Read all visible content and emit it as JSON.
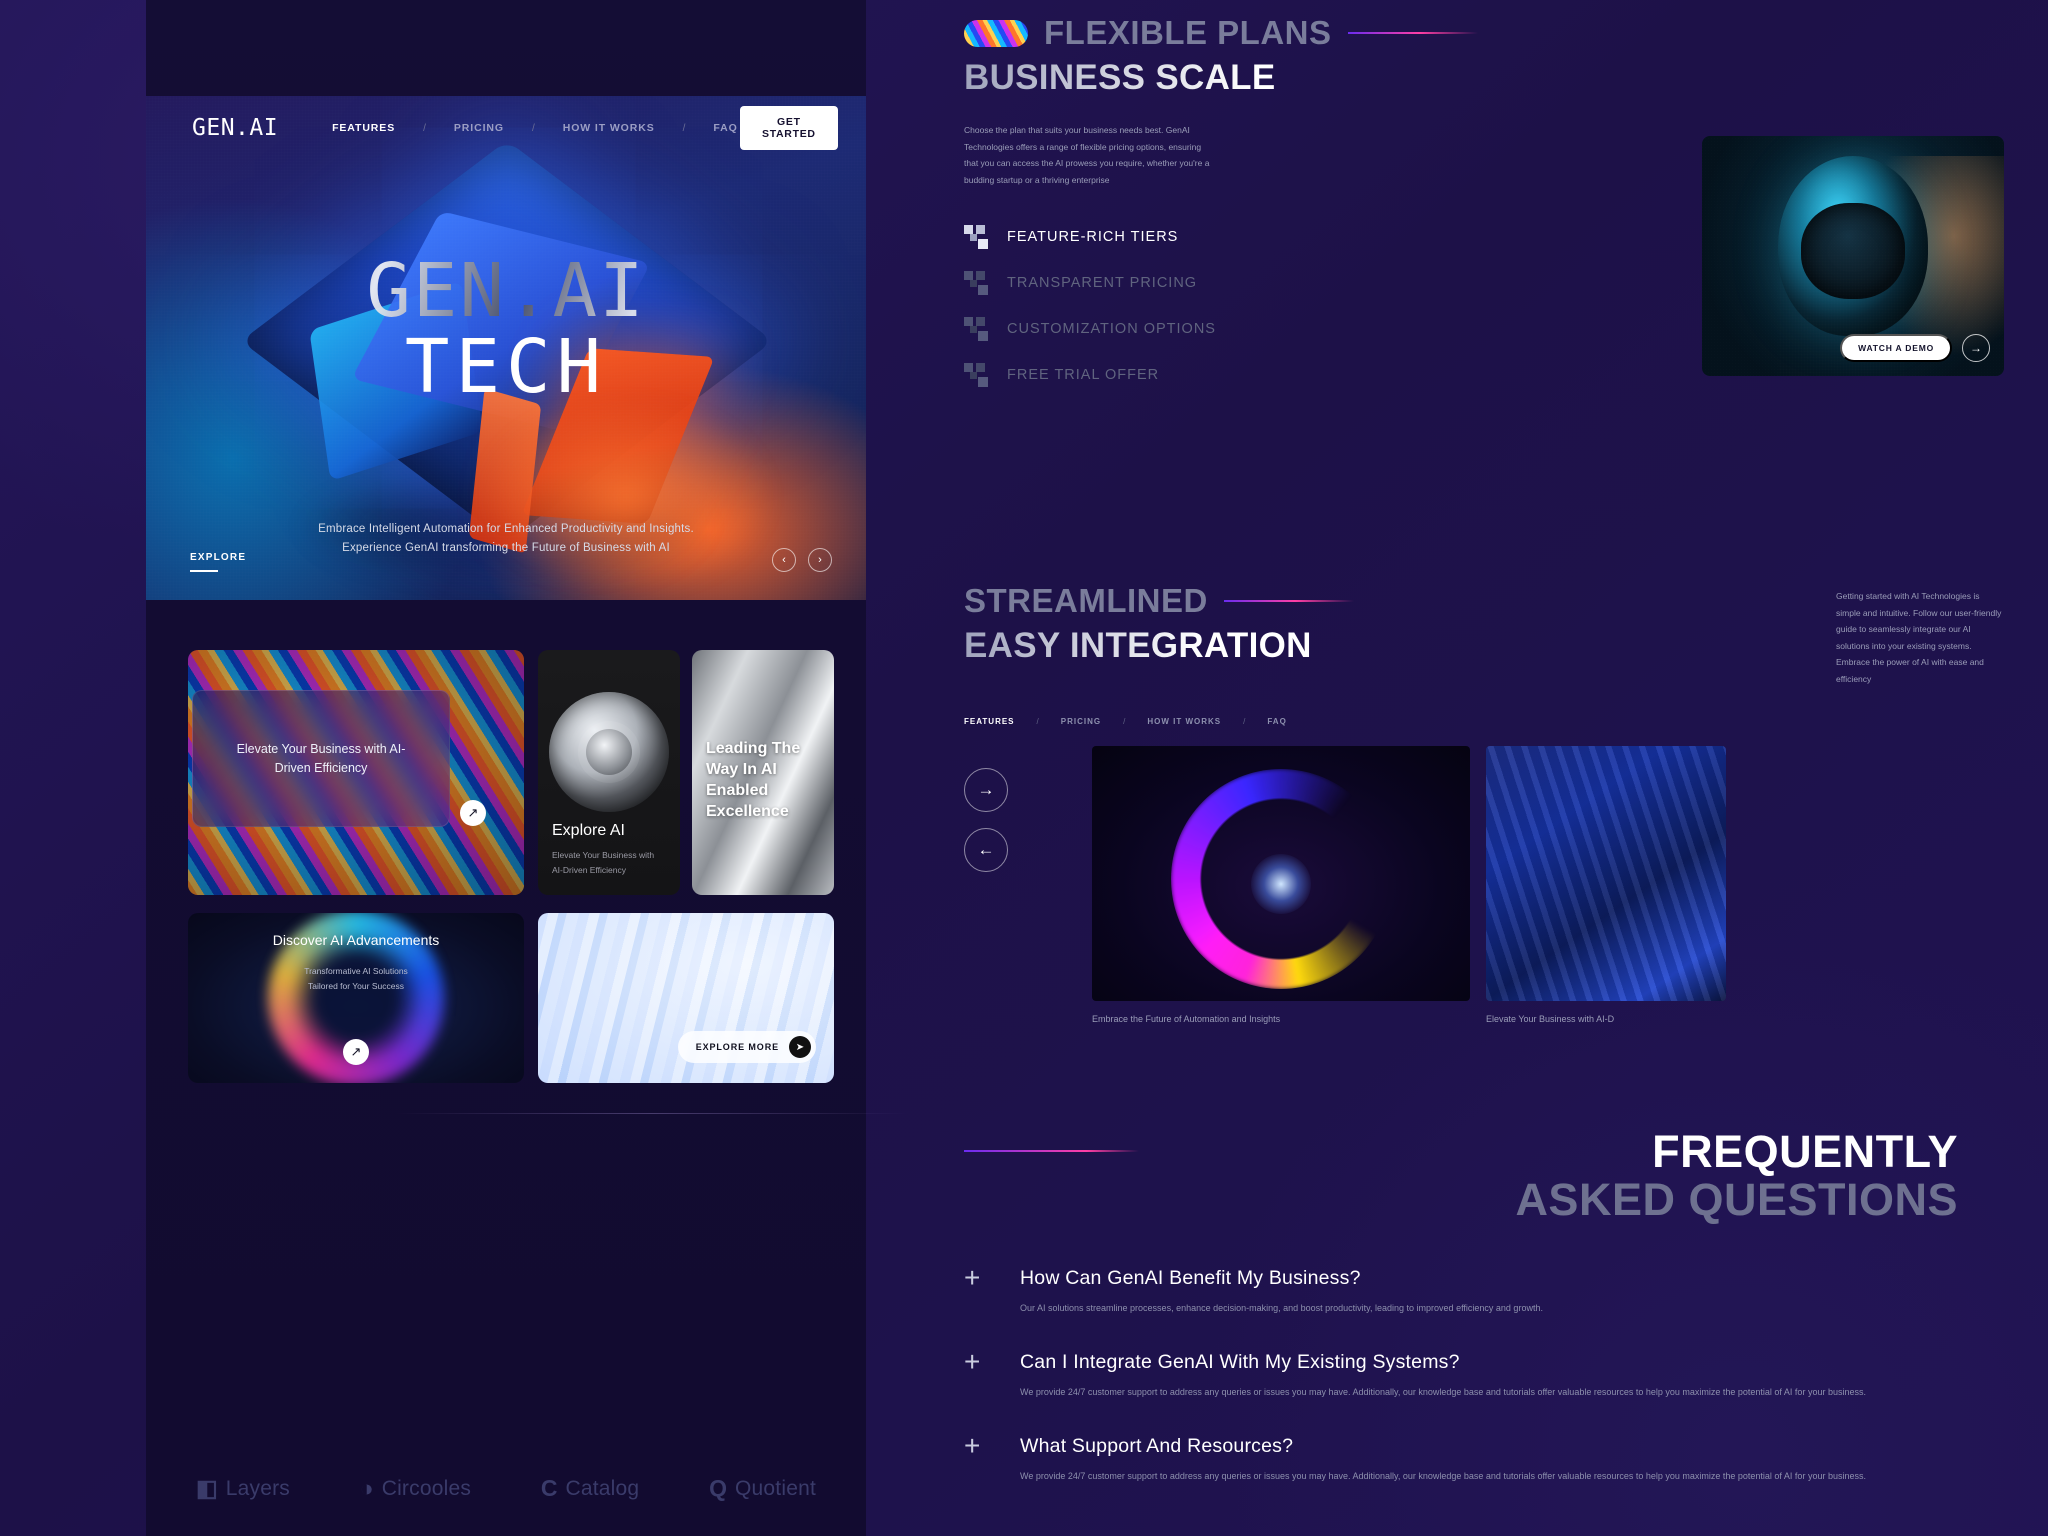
{
  "brand": {
    "logo": "GEN.AI"
  },
  "nav": {
    "links": [
      "FEATURES",
      "PRICING",
      "HOW IT WORKS",
      "FAQ"
    ],
    "separator": "/",
    "active_index": 0,
    "cta": "GET STARTED"
  },
  "hero": {
    "title_line1": "GEN.AI",
    "title_line2": "TECH",
    "subtitle_line1": "Embrace Intelligent Automation for Enhanced Productivity and Insights.",
    "subtitle_line2": "Experience GenAI  transforming the Future of Business with AI",
    "explore_label": "EXPLORE",
    "prev_icon": "‹",
    "next_icon": "›"
  },
  "cards": {
    "wide": {
      "overlay_text": "Elevate Your Business with AI-Driven Efficiency",
      "arrow_icon": "↗"
    },
    "explore_ai": {
      "title": "Explore AI",
      "subtitle": "Elevate Your Business with AI-Driven Efficiency"
    },
    "leading": {
      "title": "Leading The Way In AI Enabled Excellence"
    },
    "discover": {
      "title": "Discover AI Advancements",
      "subtitle_line1": "Transformative AI Solutions",
      "subtitle_line2": "Tailored for Your Success",
      "arrow_icon": "↗"
    },
    "explore_more": {
      "label": "EXPLORE MORE",
      "icon": "➤"
    }
  },
  "brands": [
    {
      "glyph": "◧",
      "name": "Layers"
    },
    {
      "glyph": "◑",
      "name": "Circooles"
    },
    {
      "glyph": "C",
      "name": "Catalog"
    },
    {
      "glyph": "Q",
      "name": "Quotient"
    }
  ],
  "plans": {
    "eyebrow": "FLEXIBLE PLANS",
    "title": "BUSINESS SCALE",
    "body": "Choose the plan that suits your business needs best. GenAI Technologies offers a range of flexible pricing options, ensuring that you can access the AI prowess you require, whether you're a budding startup or a thriving enterprise",
    "features": [
      {
        "label": "FEATURE-RICH TIERS",
        "active": true
      },
      {
        "label": "TRANSPARENT PRICING",
        "active": false
      },
      {
        "label": "CUSTOMIZATION OPTIONS",
        "active": false
      },
      {
        "label": "FREE TRIAL OFFER",
        "active": false
      }
    ],
    "demo_button": "WATCH A DEMO",
    "demo_arrow": "→"
  },
  "integration": {
    "eyebrow": "STREAMLINED",
    "title": "EASY INTEGRATION",
    "body": "Getting started with AI Technologies is simple and intuitive. Follow our user-friendly guide to seamlessly integrate our AI solutions into your existing systems. Embrace the power of AI with ease and efficiency",
    "mini_nav": [
      "FEATURES",
      "PRICING",
      "HOW IT WORKS",
      "FAQ"
    ],
    "mini_nav_separator": "/",
    "next_icon": "→",
    "prev_icon": "←",
    "caption_1": "Embrace the Future of Automation and Insights",
    "caption_2": "Elevate Your Business with AI-D"
  },
  "faq": {
    "title_line1": "FREQUENTLY",
    "title_line2": "ASKED QUESTIONS",
    "expand_icon": "+",
    "items": [
      {
        "question": "How Can GenAI Benefit My Business?",
        "answer": "Our AI solutions streamline processes, enhance decision-making, and boost productivity, leading to improved efficiency and growth."
      },
      {
        "question": "Can I Integrate GenAI With My Existing Systems?",
        "answer": "We provide 24/7 customer support to address any queries or issues you may have. Additionally, our knowledge base and tutorials offer valuable resources to help you maximize the potential of AI for your business."
      },
      {
        "question": "What Support And Resources?",
        "answer": "We provide 24/7 customer support to address any queries or issues you may have. Additionally, our knowledge base and tutorials offer valuable resources to help you maximize the potential of AI for your business."
      }
    ]
  },
  "colors": {
    "page_bg": "#1f1350",
    "sheet_bg": "#130c32",
    "accent_pink": "#ff3ea5",
    "accent_purple": "#6a2cf0",
    "muted_text": "#8d90ad"
  }
}
